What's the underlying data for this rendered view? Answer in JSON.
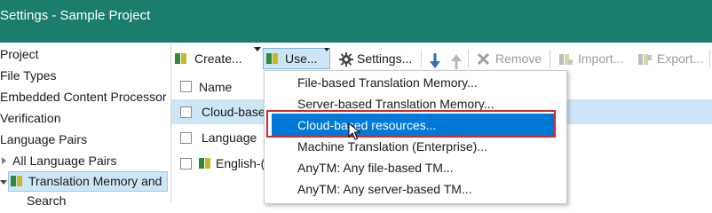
{
  "window": {
    "title": "Settings - Sample Project"
  },
  "tree": {
    "items": [
      {
        "label": "Project"
      },
      {
        "label": "File Types"
      },
      {
        "label": "Embedded Content Processor"
      },
      {
        "label": "Verification"
      },
      {
        "label": "Language Pairs"
      },
      {
        "label": "All Language Pairs"
      },
      {
        "label": "Translation Memory and"
      },
      {
        "label": "Search"
      }
    ]
  },
  "toolbar": {
    "create_label": "Create...",
    "use_label": "Use...",
    "settings_label": "Settings...",
    "remove_label": "Remove",
    "import_label": "Import...",
    "export_label": "Export..."
  },
  "grid": {
    "header_name": "Name",
    "rows": [
      {
        "name": "Cloud-base"
      },
      {
        "name": "Language"
      },
      {
        "name": "English-("
      }
    ]
  },
  "use_menu": {
    "items": [
      "File-based Translation Memory...",
      "Server-based Translation Memory...",
      "Cloud-based resources...",
      "Machine Translation (Enterprise)...",
      "AnyTM: Any file-based TM...",
      "AnyTM: Any server-based TM..."
    ],
    "highlighted_index": 2
  },
  "colors": {
    "title_bar": "#1b7d6b",
    "selection": "#cde6f7",
    "menu_highlight": "#0078d7",
    "callout_frame": "#d22b2b"
  }
}
